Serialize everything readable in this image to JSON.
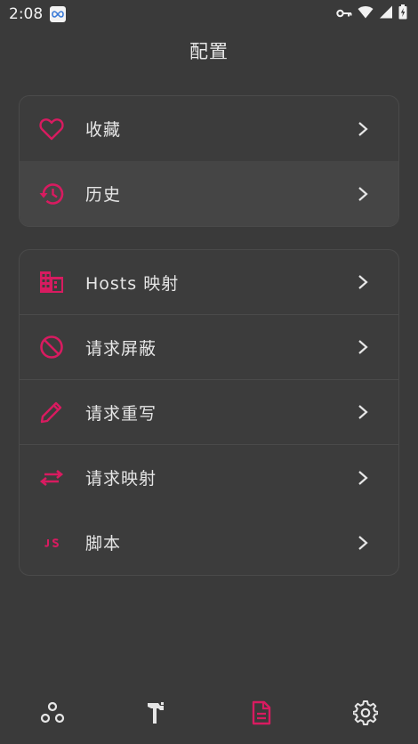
{
  "status_bar": {
    "time": "2:08"
  },
  "header": {
    "title": "配置"
  },
  "colors": {
    "accent": "#d81b60",
    "background": "#3a3a3a",
    "text": "#e6e6e6"
  },
  "card1": {
    "items": [
      {
        "label": "收藏",
        "icon": "heart-icon"
      },
      {
        "label": "历史",
        "icon": "history-icon"
      }
    ]
  },
  "card2": {
    "items": [
      {
        "label": "Hosts 映射",
        "icon": "building-icon"
      },
      {
        "label": "请求屏蔽",
        "icon": "block-icon"
      },
      {
        "label": "请求重写",
        "icon": "pencil-icon"
      },
      {
        "label": "请求映射",
        "icon": "swap-icon"
      },
      {
        "label": "脚本",
        "icon": "js-icon"
      }
    ]
  },
  "bottom_nav": {
    "items": [
      {
        "icon": "nodes-icon",
        "active": false
      },
      {
        "icon": "tools-icon",
        "active": false
      },
      {
        "icon": "document-icon",
        "active": true
      },
      {
        "icon": "gear-icon",
        "active": false
      }
    ]
  }
}
